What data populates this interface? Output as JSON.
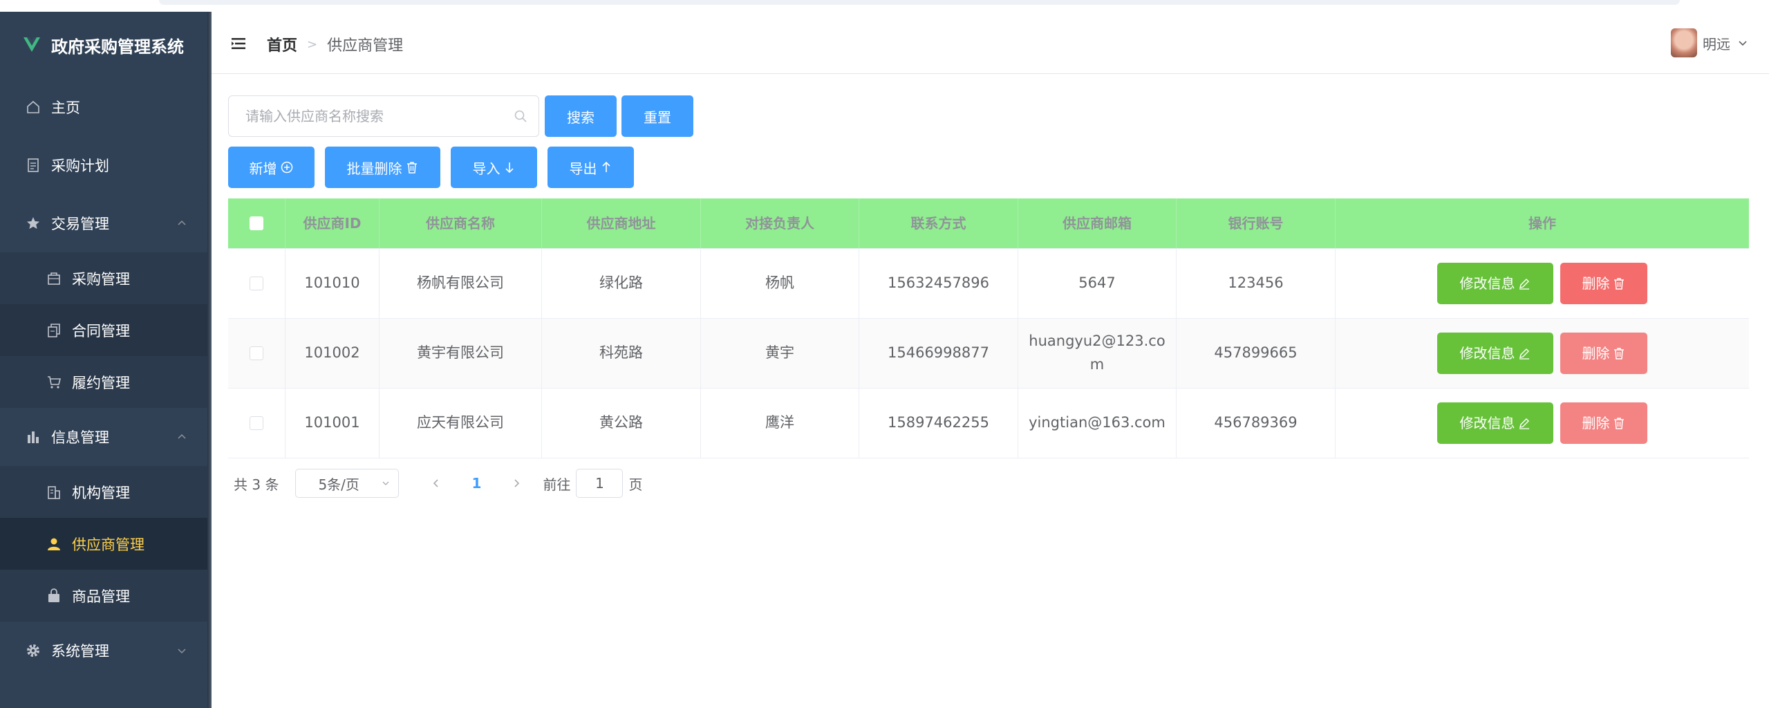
{
  "app": {
    "title": "政府采购管理系统"
  },
  "sidebar": {
    "items": [
      {
        "label": "主页"
      },
      {
        "label": "采购计划"
      },
      {
        "label": "交易管理"
      },
      {
        "label": "采购管理"
      },
      {
        "label": "合同管理"
      },
      {
        "label": "履约管理"
      },
      {
        "label": "信息管理"
      },
      {
        "label": "机构管理"
      },
      {
        "label": "供应商管理"
      },
      {
        "label": "商品管理"
      },
      {
        "label": "系统管理"
      }
    ],
    "active_color": "#ffd04b",
    "bg_color": "#304156"
  },
  "header": {
    "breadcrumb_home": "首页",
    "breadcrumb_current": "供应商管理",
    "user_name": "明远"
  },
  "search": {
    "placeholder": "请输入供应商名称搜索",
    "search_label": "搜索",
    "reset_label": "重置"
  },
  "toolbar": {
    "add_label": "新增",
    "batch_delete_label": "批量删除",
    "import_label": "导入",
    "export_label": "导出"
  },
  "table": {
    "header_color": "#90ee90",
    "columns": [
      "供应商ID",
      "供应商名称",
      "供应商地址",
      "对接负责人",
      "联系方式",
      "供应商邮箱",
      "银行账号",
      "操作"
    ],
    "rows": [
      {
        "id": "101010",
        "name": "杨帆有限公司",
        "address": "绿化路",
        "contact": "杨帆",
        "phone": "15632457896",
        "email": "5647",
        "bank": "123456"
      },
      {
        "id": "101002",
        "name": "黄宇有限公司",
        "address": "科苑路",
        "contact": "黄宇",
        "phone": "15466998877",
        "email": "huangyu2@123.com",
        "bank": "457899665"
      },
      {
        "id": "101001",
        "name": "应天有限公司",
        "address": "黄公路",
        "contact": "鹰洋",
        "phone": "15897462255",
        "email": "yingtian@163.com",
        "bank": "456789369"
      }
    ],
    "edit_label": "修改信息",
    "delete_label": "删除",
    "edit_color": "#67c23a",
    "delete_color": "#f56c6c"
  },
  "pagination": {
    "total_text": "共 3 条",
    "page_size": "5条/页",
    "current_page": "1",
    "goto_prefix": "前往",
    "goto_value": "1",
    "goto_suffix": "页"
  },
  "icons": [
    "vue-logo-icon",
    "home-icon",
    "document-icon",
    "star-icon",
    "bag-icon",
    "copy-icon",
    "cart-icon",
    "bar-chart-icon",
    "office-building-icon",
    "user-icon",
    "shopping-bag-icon",
    "gear-icon",
    "hamburger-icon",
    "search-icon",
    "circle-plus-icon",
    "delete-icon",
    "arrow-down-icon",
    "arrow-up-icon",
    "edit-pen-icon",
    "chevron-up-icon",
    "chevron-down-icon",
    "chevron-left-icon",
    "chevron-right-icon"
  ]
}
